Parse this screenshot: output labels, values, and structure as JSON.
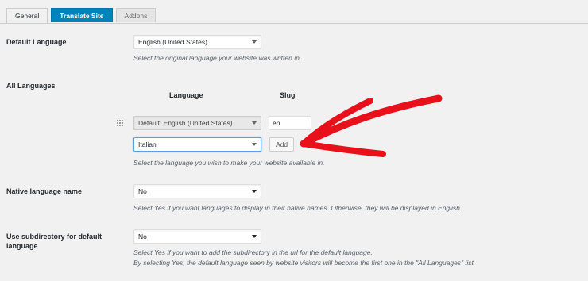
{
  "tabs": [
    {
      "label": "General"
    },
    {
      "label": "Translate Site"
    },
    {
      "label": "Addons"
    }
  ],
  "default_language": {
    "label": "Default Language",
    "value": "English (United States)",
    "description": "Select the original language your website was written in."
  },
  "all_languages": {
    "label": "All Languages",
    "col_language": "Language",
    "col_slug": "Slug",
    "default_row": {
      "value": "Default: English (United States)",
      "slug": "en"
    },
    "new_row": {
      "value": "Italian",
      "button": "Add"
    },
    "description": "Select the language you wish to make your website available in."
  },
  "native_name": {
    "label": "Native language name",
    "value": "No",
    "description": "Select Yes if you want languages to display in their native names. Otherwise, they will be displayed in English."
  },
  "subdirectory": {
    "label_line1": "Use subdirectory for default",
    "label_line2": "language",
    "value": "No",
    "description_line1": "Select Yes if you want to add the subdirectory in the url for the default language.",
    "description_line2": "By selecting Yes, the default language seen by website visitors will become the first one in the \"All Languages\" list."
  },
  "colors": {
    "accent": "#0085ba",
    "arrow": "#e8101a",
    "background": "#f1f1f1"
  }
}
